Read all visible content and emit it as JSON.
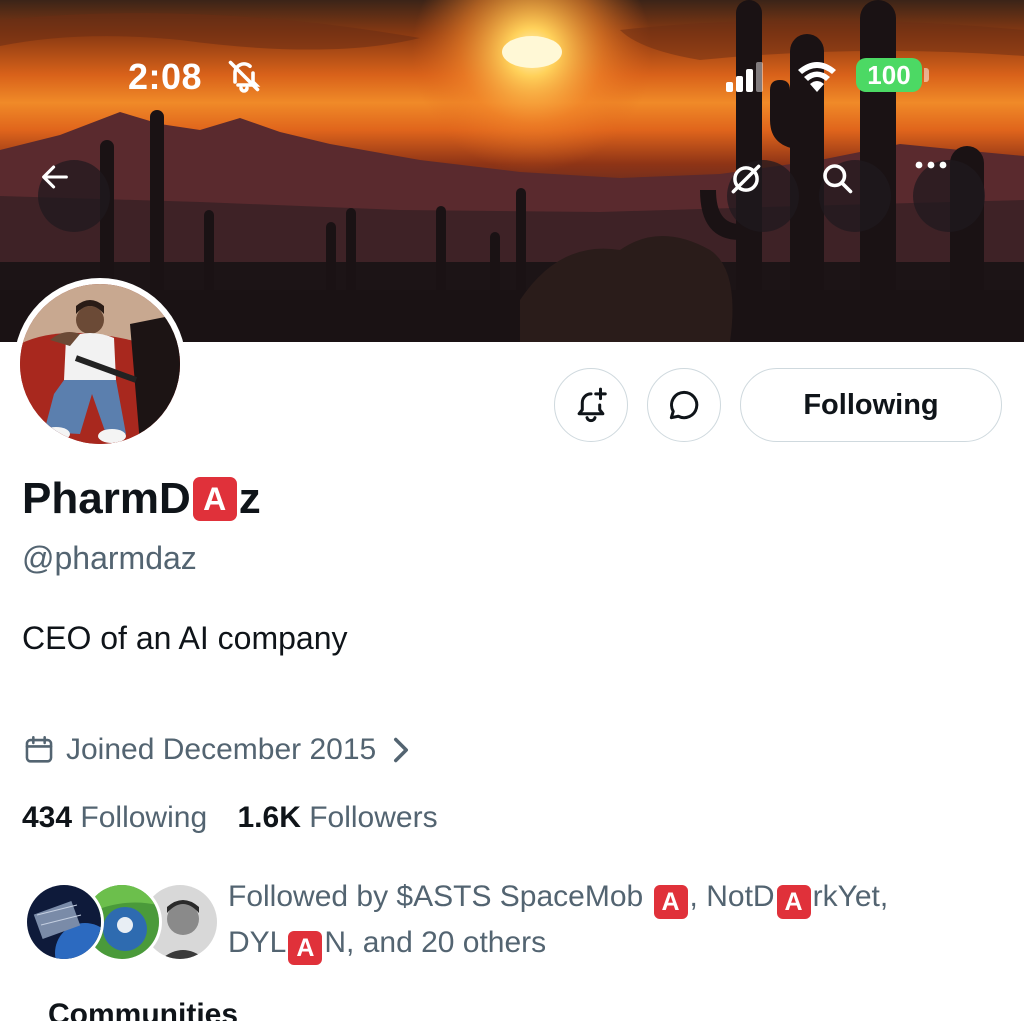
{
  "status_bar": {
    "time": "2:08",
    "battery": "100",
    "icons": [
      "bell-slash-icon",
      "cellular-signal-icon",
      "wifi-icon",
      "battery-icon"
    ]
  },
  "banner": {
    "buttons": [
      "back-arrow-icon",
      "grok-icon",
      "search-icon",
      "more-icon"
    ]
  },
  "actions": {
    "notify_icon": "bell-plus-icon",
    "message_icon": "message-bubble-icon",
    "following_label": "Following"
  },
  "profile": {
    "name_prefix": "PharmD",
    "name_emoji": "A",
    "name_suffix": "z",
    "handle": "@pharmdaz",
    "bio": "CEO of an AI company",
    "joined": "Joined December 2015",
    "following_count": "434",
    "following_label": "Following",
    "followers_count": "1.6K",
    "followers_label": "Followers"
  },
  "followed_by": {
    "prefix": "Followed by $ASTS SpaceMob ",
    "emoji": "A",
    "part2": ", NotD",
    "part3": "rkYet,",
    "part4": "DYL",
    "part5": "N, and 20 others"
  },
  "section": {
    "communities": "Communities"
  },
  "colors": {
    "text_primary": "#0f1419",
    "text_secondary": "#536471",
    "border": "#cfd9de",
    "battery": "#4cd964",
    "emoji_red": "#e0313a"
  }
}
